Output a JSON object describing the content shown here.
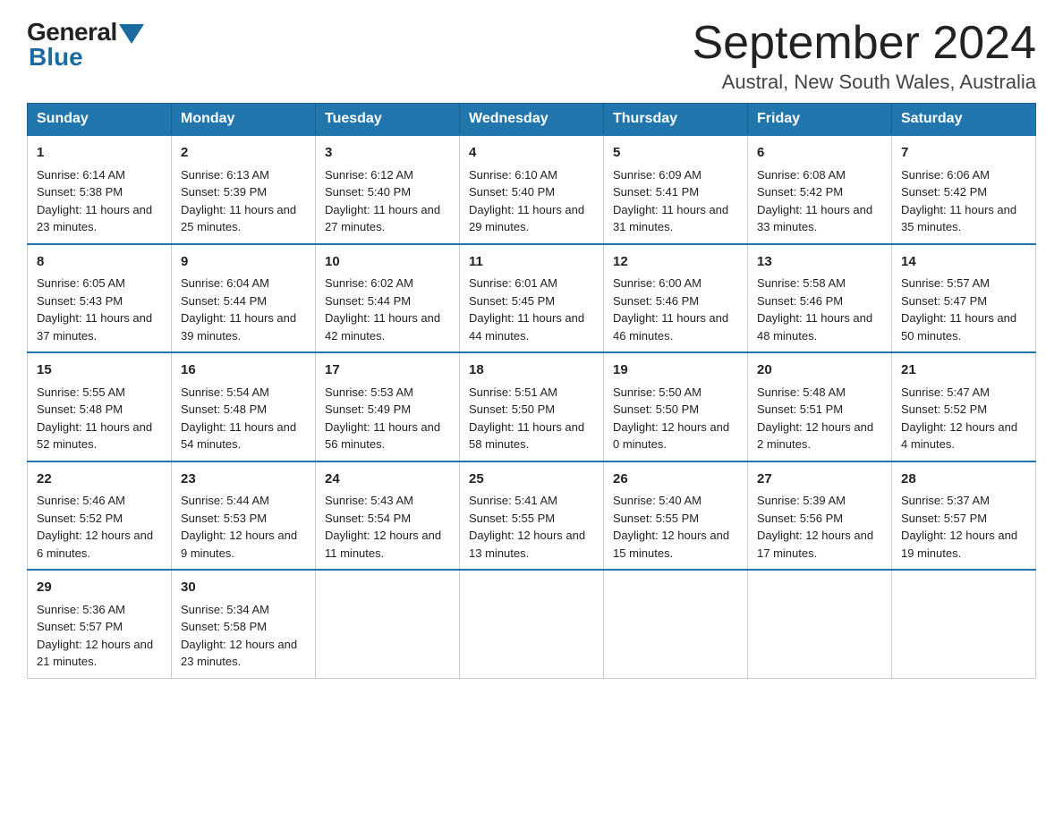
{
  "header": {
    "logo_general": "General",
    "logo_blue": "Blue",
    "month_year": "September 2024",
    "location": "Austral, New South Wales, Australia"
  },
  "days": [
    "Sunday",
    "Monday",
    "Tuesday",
    "Wednesday",
    "Thursday",
    "Friday",
    "Saturday"
  ],
  "weeks": [
    [
      {
        "num": "1",
        "sunrise": "6:14 AM",
        "sunset": "5:38 PM",
        "daylight": "11 hours and 23 minutes."
      },
      {
        "num": "2",
        "sunrise": "6:13 AM",
        "sunset": "5:39 PM",
        "daylight": "11 hours and 25 minutes."
      },
      {
        "num": "3",
        "sunrise": "6:12 AM",
        "sunset": "5:40 PM",
        "daylight": "11 hours and 27 minutes."
      },
      {
        "num": "4",
        "sunrise": "6:10 AM",
        "sunset": "5:40 PM",
        "daylight": "11 hours and 29 minutes."
      },
      {
        "num": "5",
        "sunrise": "6:09 AM",
        "sunset": "5:41 PM",
        "daylight": "11 hours and 31 minutes."
      },
      {
        "num": "6",
        "sunrise": "6:08 AM",
        "sunset": "5:42 PM",
        "daylight": "11 hours and 33 minutes."
      },
      {
        "num": "7",
        "sunrise": "6:06 AM",
        "sunset": "5:42 PM",
        "daylight": "11 hours and 35 minutes."
      }
    ],
    [
      {
        "num": "8",
        "sunrise": "6:05 AM",
        "sunset": "5:43 PM",
        "daylight": "11 hours and 37 minutes."
      },
      {
        "num": "9",
        "sunrise": "6:04 AM",
        "sunset": "5:44 PM",
        "daylight": "11 hours and 39 minutes."
      },
      {
        "num": "10",
        "sunrise": "6:02 AM",
        "sunset": "5:44 PM",
        "daylight": "11 hours and 42 minutes."
      },
      {
        "num": "11",
        "sunrise": "6:01 AM",
        "sunset": "5:45 PM",
        "daylight": "11 hours and 44 minutes."
      },
      {
        "num": "12",
        "sunrise": "6:00 AM",
        "sunset": "5:46 PM",
        "daylight": "11 hours and 46 minutes."
      },
      {
        "num": "13",
        "sunrise": "5:58 AM",
        "sunset": "5:46 PM",
        "daylight": "11 hours and 48 minutes."
      },
      {
        "num": "14",
        "sunrise": "5:57 AM",
        "sunset": "5:47 PM",
        "daylight": "11 hours and 50 minutes."
      }
    ],
    [
      {
        "num": "15",
        "sunrise": "5:55 AM",
        "sunset": "5:48 PM",
        "daylight": "11 hours and 52 minutes."
      },
      {
        "num": "16",
        "sunrise": "5:54 AM",
        "sunset": "5:48 PM",
        "daylight": "11 hours and 54 minutes."
      },
      {
        "num": "17",
        "sunrise": "5:53 AM",
        "sunset": "5:49 PM",
        "daylight": "11 hours and 56 minutes."
      },
      {
        "num": "18",
        "sunrise": "5:51 AM",
        "sunset": "5:50 PM",
        "daylight": "11 hours and 58 minutes."
      },
      {
        "num": "19",
        "sunrise": "5:50 AM",
        "sunset": "5:50 PM",
        "daylight": "12 hours and 0 minutes."
      },
      {
        "num": "20",
        "sunrise": "5:48 AM",
        "sunset": "5:51 PM",
        "daylight": "12 hours and 2 minutes."
      },
      {
        "num": "21",
        "sunrise": "5:47 AM",
        "sunset": "5:52 PM",
        "daylight": "12 hours and 4 minutes."
      }
    ],
    [
      {
        "num": "22",
        "sunrise": "5:46 AM",
        "sunset": "5:52 PM",
        "daylight": "12 hours and 6 minutes."
      },
      {
        "num": "23",
        "sunrise": "5:44 AM",
        "sunset": "5:53 PM",
        "daylight": "12 hours and 9 minutes."
      },
      {
        "num": "24",
        "sunrise": "5:43 AM",
        "sunset": "5:54 PM",
        "daylight": "12 hours and 11 minutes."
      },
      {
        "num": "25",
        "sunrise": "5:41 AM",
        "sunset": "5:55 PM",
        "daylight": "12 hours and 13 minutes."
      },
      {
        "num": "26",
        "sunrise": "5:40 AM",
        "sunset": "5:55 PM",
        "daylight": "12 hours and 15 minutes."
      },
      {
        "num": "27",
        "sunrise": "5:39 AM",
        "sunset": "5:56 PM",
        "daylight": "12 hours and 17 minutes."
      },
      {
        "num": "28",
        "sunrise": "5:37 AM",
        "sunset": "5:57 PM",
        "daylight": "12 hours and 19 minutes."
      }
    ],
    [
      {
        "num": "29",
        "sunrise": "5:36 AM",
        "sunset": "5:57 PM",
        "daylight": "12 hours and 21 minutes."
      },
      {
        "num": "30",
        "sunrise": "5:34 AM",
        "sunset": "5:58 PM",
        "daylight": "12 hours and 23 minutes."
      },
      null,
      null,
      null,
      null,
      null
    ]
  ]
}
